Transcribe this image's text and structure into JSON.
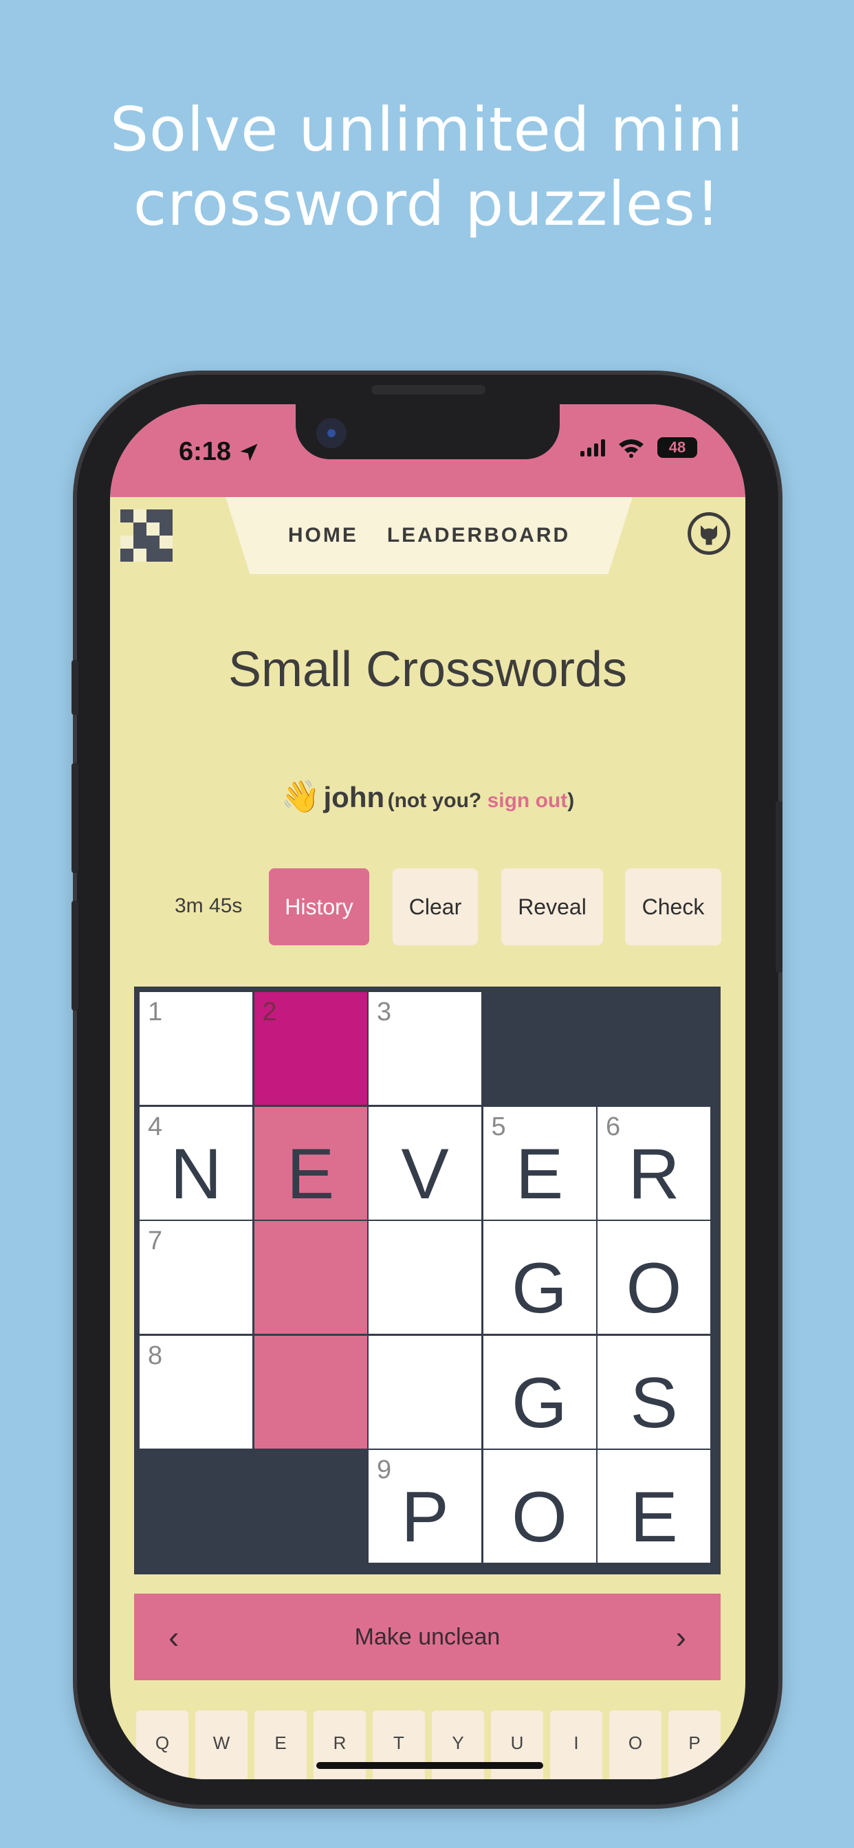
{
  "headline": "Solve unlimited mini crossword puzzles!",
  "status_bar": {
    "time": "6:18",
    "battery": "48",
    "location_icon": "location-arrow-icon",
    "wifi_icon": "wifi-icon",
    "signal_icon": "cellular-signal-icon"
  },
  "nav": {
    "home": "HOME",
    "leaderboard": "LEADERBOARD",
    "logo_icon": "crossword-logo-icon",
    "github_icon": "github-icon"
  },
  "page_title": "Small Crosswords",
  "greeting": {
    "wave": "👋",
    "name": "john",
    "prefix": "(not you? ",
    "signout": "sign out",
    "suffix": ")"
  },
  "toolbar": {
    "timer": "3m 45s",
    "history": "History",
    "clear": "Clear",
    "reveal": "Reveal",
    "check": "Check"
  },
  "grid": {
    "rows": [
      [
        {
          "n": "1",
          "l": "",
          "s": "white"
        },
        {
          "n": "2",
          "l": "",
          "s": "selected"
        },
        {
          "n": "3",
          "l": "",
          "s": "white"
        },
        {
          "b": true
        },
        {
          "b": true
        }
      ],
      [
        {
          "n": "4",
          "l": "N",
          "s": "white"
        },
        {
          "n": "",
          "l": "E",
          "s": "highlight"
        },
        {
          "n": "",
          "l": "V",
          "s": "white"
        },
        {
          "n": "5",
          "l": "E",
          "s": "white"
        },
        {
          "n": "6",
          "l": "R",
          "s": "white"
        }
      ],
      [
        {
          "n": "7",
          "l": "",
          "s": "white"
        },
        {
          "n": "",
          "l": "",
          "s": "highlight"
        },
        {
          "n": "",
          "l": "",
          "s": "white"
        },
        {
          "n": "",
          "l": "G",
          "s": "white"
        },
        {
          "n": "",
          "l": "O",
          "s": "white"
        }
      ],
      [
        {
          "n": "8",
          "l": "",
          "s": "white"
        },
        {
          "n": "",
          "l": "",
          "s": "highlight"
        },
        {
          "n": "",
          "l": "",
          "s": "white"
        },
        {
          "n": "",
          "l": "G",
          "s": "white"
        },
        {
          "n": "",
          "l": "S",
          "s": "white"
        }
      ],
      [
        {
          "b": true
        },
        {
          "b": true
        },
        {
          "n": "9",
          "l": "P",
          "s": "white"
        },
        {
          "n": "",
          "l": "O",
          "s": "white"
        },
        {
          "n": "",
          "l": "E",
          "s": "white"
        }
      ]
    ]
  },
  "clue": {
    "text": "Make unclean",
    "prev": "‹",
    "next": "›"
  },
  "keyboard": [
    "Q",
    "W",
    "E",
    "R",
    "T",
    "Y",
    "U",
    "I",
    "O",
    "P"
  ],
  "colors": {
    "background": "#98c8e5",
    "accent": "#dc6f8f",
    "selected": "#c4197f",
    "page": "#ede6a9",
    "block": "#353c4a"
  }
}
